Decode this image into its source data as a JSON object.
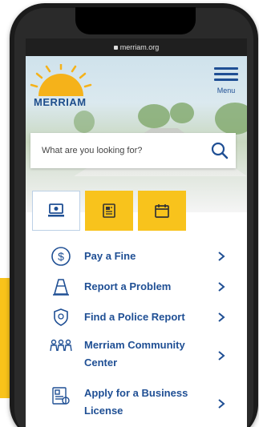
{
  "browser": {
    "url": "merriam.org"
  },
  "header": {
    "logo_text": "MERRIAM",
    "menu_label": "Menu"
  },
  "search": {
    "placeholder": "What are you looking for?"
  },
  "tabs": [
    {
      "icon": "laptop-icon",
      "active": true
    },
    {
      "icon": "document-icon",
      "active": false
    },
    {
      "icon": "calendar-icon",
      "active": false
    }
  ],
  "quick_links": [
    {
      "icon": "dollar-icon",
      "label": "Pay a Fine"
    },
    {
      "icon": "traffic-cone-icon",
      "label": "Report a Problem"
    },
    {
      "icon": "police-badge-icon",
      "label": "Find a Police Report"
    },
    {
      "icon": "community-people-icon",
      "label": "Merriam Community Center"
    },
    {
      "icon": "business-license-icon",
      "label": "Apply for a Business License"
    }
  ],
  "colors": {
    "brand_blue": "#1f4f94",
    "accent_yellow": "#f8c31c"
  }
}
